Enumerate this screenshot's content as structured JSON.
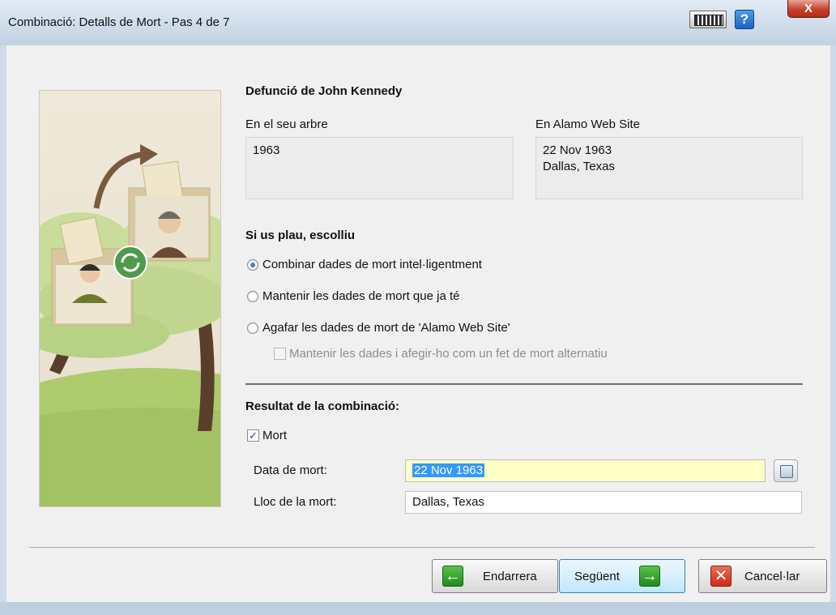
{
  "window": {
    "title": "Combinació: Detalls de Mort - Pas 4 de 7",
    "help_label": "?",
    "close_label": "X"
  },
  "death": {
    "heading": "Defunció de John Kennedy",
    "tree_label": "En el seu arbre",
    "tree_value_line1": "1963",
    "web_label": "En Alamo Web Site",
    "web_value_line1": "22 Nov 1963",
    "web_value_line2": "Dallas, Texas"
  },
  "choose": {
    "heading": "Si us plau, escolliu",
    "options": [
      {
        "label": "Combinar dades de mort intel·ligentment",
        "selected": true
      },
      {
        "label": "Mantenir les dades de mort que ja té",
        "selected": false
      },
      {
        "label": "Agafar les dades de mort de 'Alamo Web Site'",
        "selected": false
      }
    ],
    "alternative_label": "Mantenir les dades i afegir-ho com un fet de mort alternatiu"
  },
  "result": {
    "heading": "Resultat de la combinació:",
    "mort_label": "Mort",
    "mort_checked": true,
    "date_label": "Data de mort:",
    "date_value": "22 Nov 1963",
    "place_label": "Lloc de la mort:",
    "place_value": "Dallas, Texas"
  },
  "buttons": {
    "back": "Endarrera",
    "next": "Següent",
    "cancel": "Cancel·lar"
  },
  "colors": {
    "content_bg": "#f0f0f0",
    "date_highlight": "#ffffc6",
    "selection": "#3399ff",
    "green_icon": "#2fa32b",
    "red_icon": "#e0412c"
  }
}
